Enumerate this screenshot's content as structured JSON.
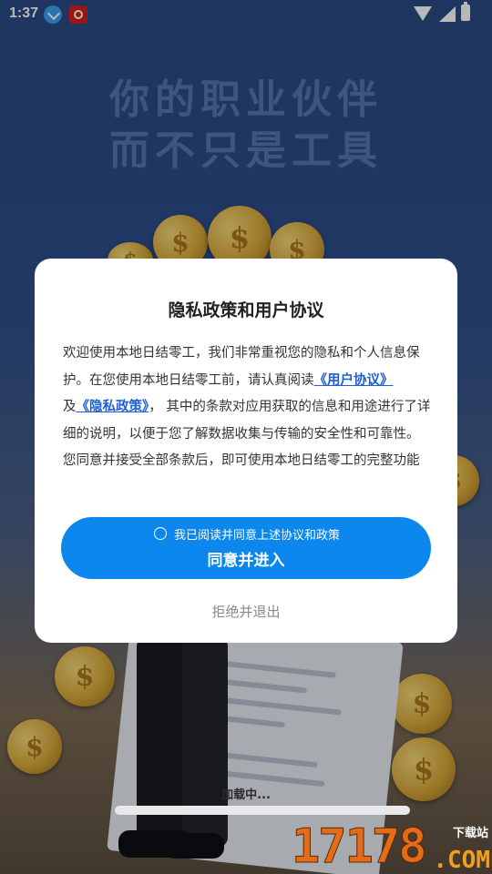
{
  "status_bar": {
    "time": "1:37",
    "icons": [
      "download-icon",
      "app-notification-icon",
      "wifi-icon",
      "signal-icon",
      "battery-icon"
    ]
  },
  "background": {
    "slogan_line1": "你的职业伙伴",
    "slogan_line2": "而不只是工具"
  },
  "dialog": {
    "title": "隐私政策和用户协议",
    "body_part1": "欢迎使用本地日结零工，我们非常重视您的隐私和个人信息保护。在您使用本地日结零工前，请认真阅读",
    "user_agreement_link": "《用户协议》",
    "body_part2": "及",
    "privacy_policy_link": "《隐私政策》",
    "body_part3": "， 其中的条款对应用获取的信息和用途进行了详细的说明，以便于您了解数据收集与传输的安全性和可靠性。您同意并接受全部条款后，即可使用本地日结零工的完整功能",
    "consent_note": "我已阅读并同意上述协议和政策",
    "consent_checked": false,
    "agree_button": "同意并进入",
    "reject_button": "拒绝并退出"
  },
  "loading_text": "加载中...",
  "watermark": {
    "number": "17178",
    "site_label": "下载站",
    "suffix": ".COM"
  },
  "colors": {
    "accent": "#0b87ee",
    "link": "#1f5fd6"
  }
}
